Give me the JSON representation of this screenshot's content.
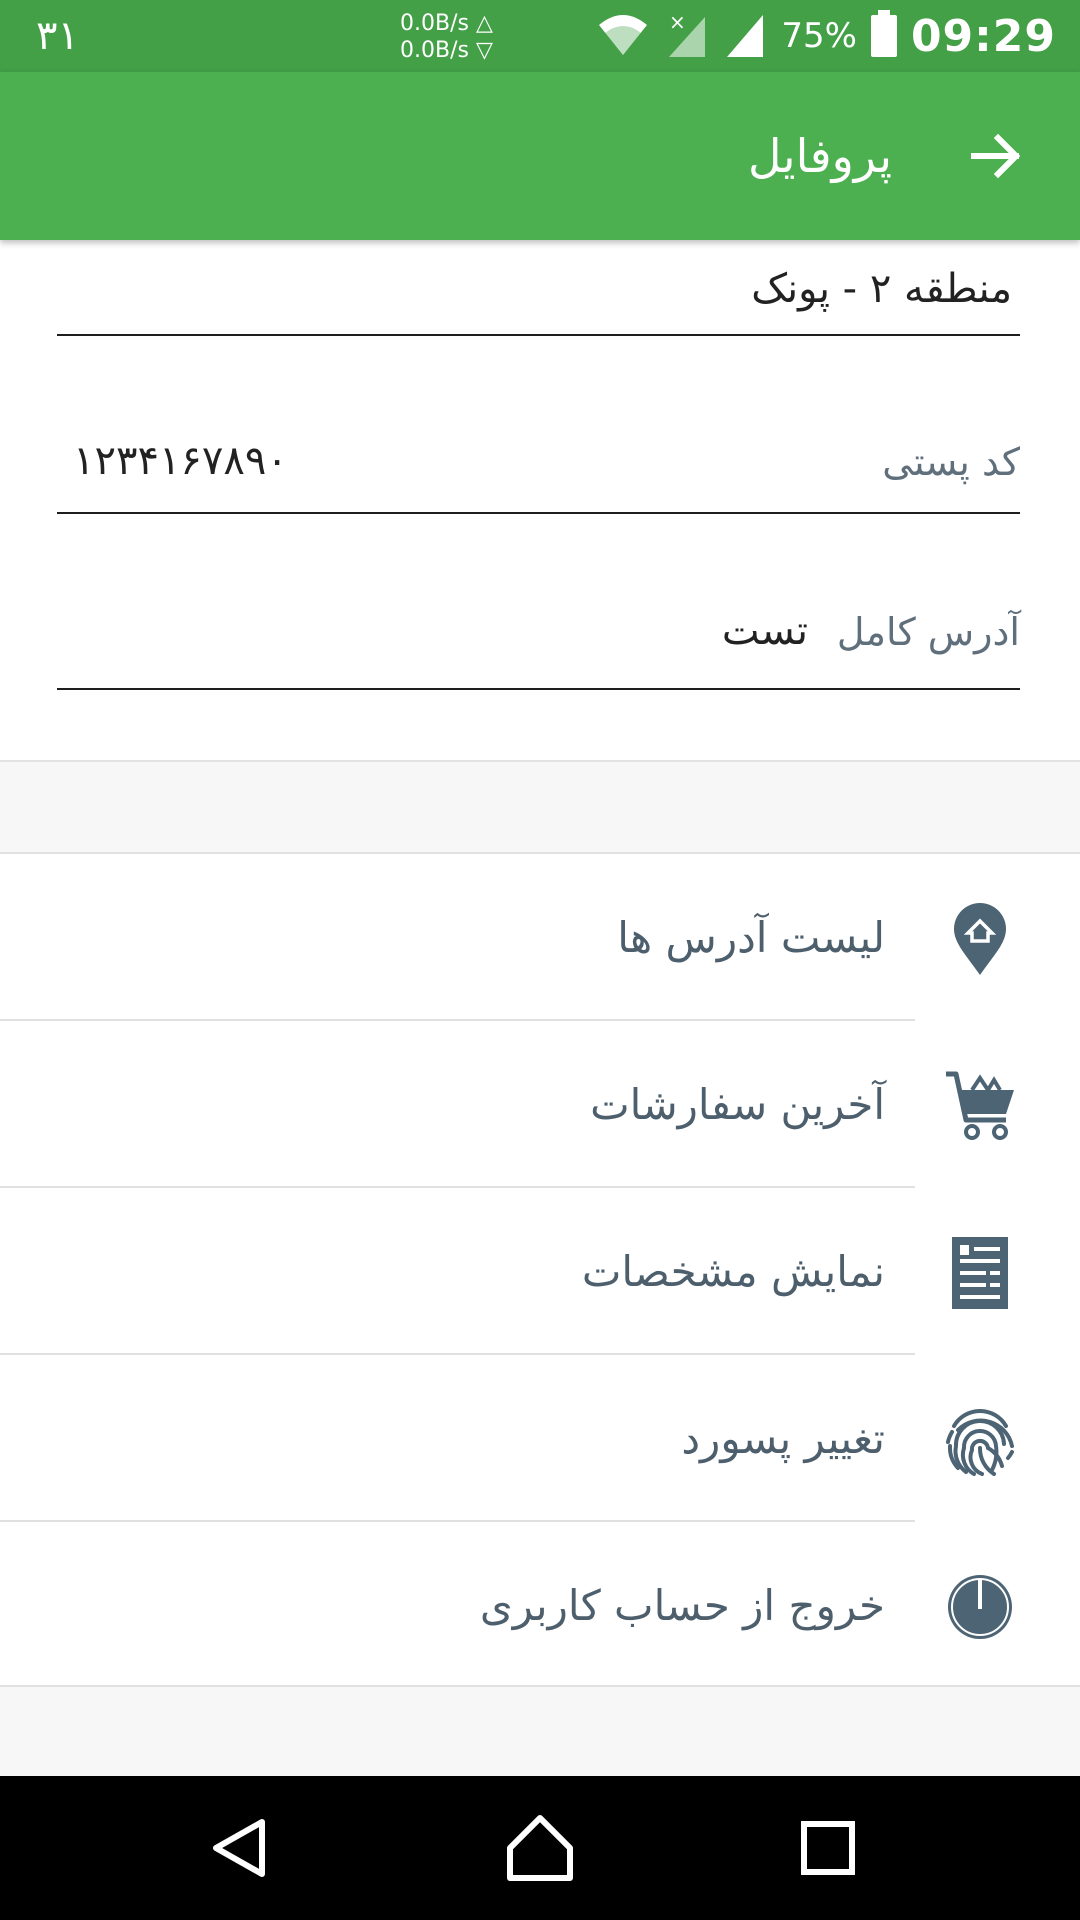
{
  "status_bar": {
    "date": "۳۱",
    "net_up": "0.0B/s △",
    "net_down": "0.0B/s ▽",
    "battery_pct": "75%",
    "time": "09:29",
    "icons": [
      "wifi-icon",
      "signal-x-icon",
      "signal-icon",
      "battery-icon"
    ]
  },
  "appbar": {
    "title": "پروفایل",
    "back_icon": "arrow-right-icon"
  },
  "form": {
    "region_value": "منطقه ۲ - پونک",
    "postal_label": "کد پستی",
    "postal_value": "۱۲۳۴۱۶۷۸۹۰",
    "address_label": "آدرس کامل",
    "address_value": "تست"
  },
  "menu": {
    "items": [
      {
        "label": "لیست آدرس ها",
        "icon": "location-home-icon"
      },
      {
        "label": "آخرین سفارشات",
        "icon": "cart-icon"
      },
      {
        "label": "نمایش مشخصات",
        "icon": "id-card-icon"
      },
      {
        "label": "تغییر پسورد",
        "icon": "fingerprint-icon"
      },
      {
        "label": "خروج از حساب کاربری",
        "icon": "power-icon"
      }
    ]
  },
  "colors": {
    "status_bar": "#43a047",
    "appbar": "#4caf50",
    "icon": "#4d6474",
    "menu_text": "#4d5f6c"
  }
}
